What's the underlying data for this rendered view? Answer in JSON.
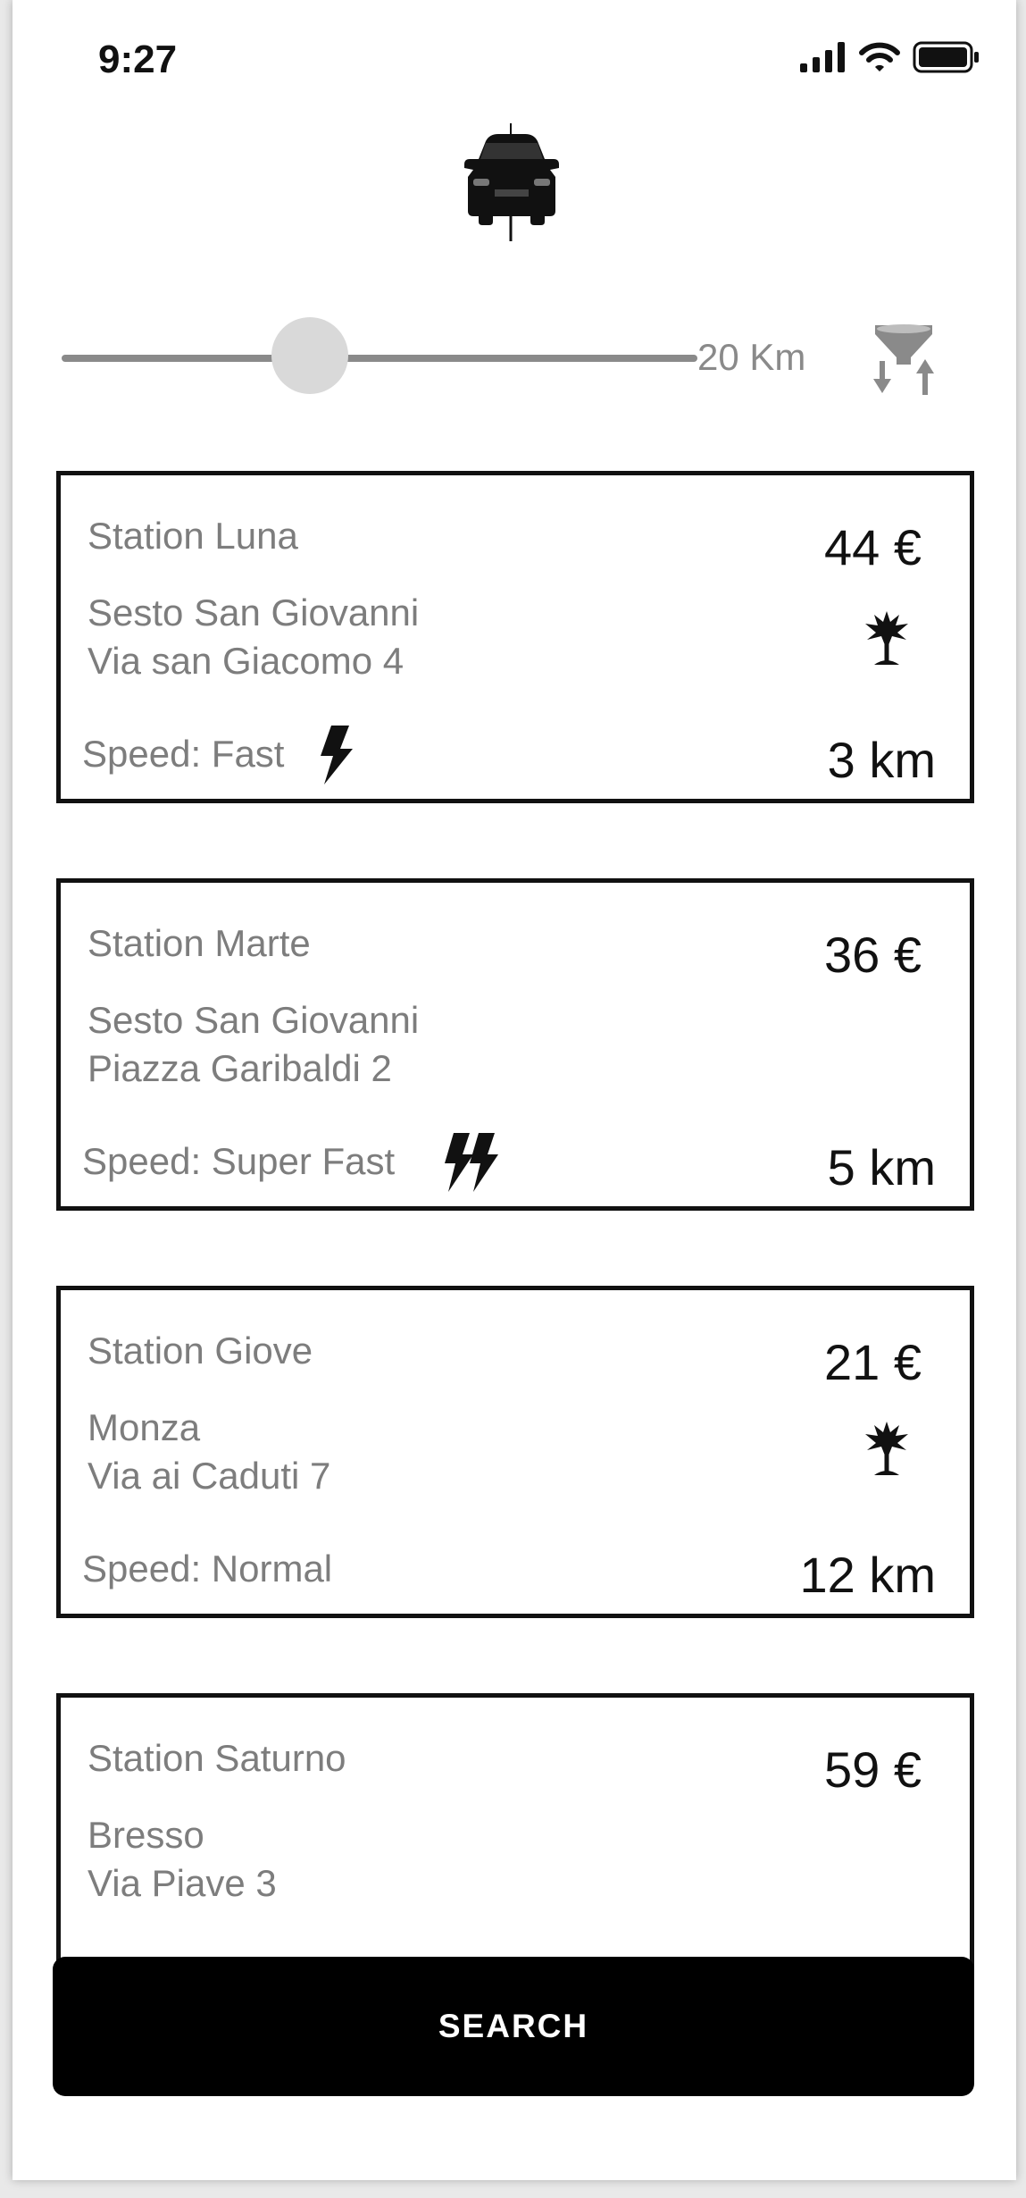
{
  "status_bar": {
    "time": "9:27",
    "signal_icon": "signal-bars-icon",
    "wifi_icon": "wifi-icon",
    "battery_icon": "battery-icon"
  },
  "header": {
    "icon": "car-charging-icon"
  },
  "distance_filter": {
    "slider_fraction": 0.39,
    "value_label": "20 Km",
    "sort_filter_icon": "filter-sort-icon"
  },
  "stations": [
    {
      "name": "Station Luna",
      "city": "Sesto San Giovanni",
      "street": "Via san Giacomo 4",
      "speed": "Speed: Fast",
      "speed_icon": "bolt-icon",
      "price": "44 €",
      "distance": "3 km",
      "eco": true
    },
    {
      "name": "Station Marte",
      "city": "Sesto San Giovanni",
      "street": "Piazza Garibaldi 2",
      "speed": "Speed: Super Fast",
      "speed_icon": "double-bolt-icon",
      "price": "36 €",
      "distance": "5 km",
      "eco": false
    },
    {
      "name": "Station Giove",
      "city": "Monza",
      "street": "Via ai Caduti 7",
      "speed": "Speed: Normal",
      "speed_icon": "",
      "price": "21 €",
      "distance": "12 km",
      "eco": true
    },
    {
      "name": "Station Saturno",
      "city": "Bresso",
      "street": "Via Piave 3",
      "price": "59 €"
    }
  ],
  "search_button": {
    "label": "SEARCH"
  },
  "colors": {
    "primary": "#000000",
    "muted_text": "#7d7d7d",
    "slider_track": "#8a8a8a",
    "slider_thumb": "#d9d9d9"
  }
}
